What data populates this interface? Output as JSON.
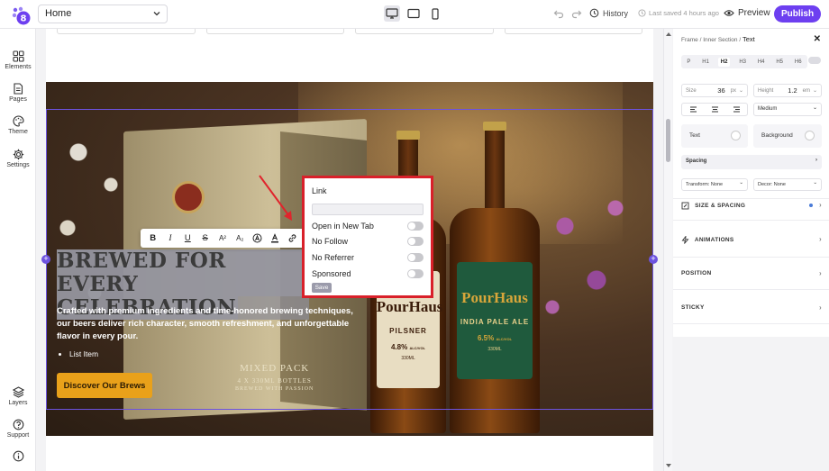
{
  "topbar": {
    "page_name": "Home",
    "history_label": "History",
    "saved_label": "Last saved 4 hours ago",
    "preview_label": "Preview",
    "publish_label": "Publish",
    "accent_color": "#6d3ff0"
  },
  "leftbar": {
    "items": [
      {
        "label": "Elements",
        "icon": "grid-icon"
      },
      {
        "label": "Pages",
        "icon": "document-icon"
      },
      {
        "label": "Theme",
        "icon": "palette-icon"
      },
      {
        "label": "Settings",
        "icon": "gear-icon"
      },
      {
        "label": "Layers",
        "icon": "layers-icon"
      },
      {
        "label": "Support",
        "icon": "help-icon"
      }
    ],
    "info_icon": "info-icon"
  },
  "hero": {
    "heading_line1": "BREWED FOR EVERY",
    "heading_line2": "CELEBRATION",
    "paragraph": "Crafted with premium ingredients and time-honored brewing techniques, our beers deliver rich character, smooth refreshment, and unforgettable flavor in every pour.",
    "list_item": "List Item",
    "cta_label": "Discover Our Brews",
    "box_label_1": "MIXED PACK",
    "box_label_2": "4 X 330ML BOTTLES",
    "box_label_3": "BREWED WITH PASSION",
    "bottle1": {
      "brand": "PourHaus",
      "style": "PILSNER",
      "abv": "4.8%",
      "abv_unit": "ALC/VOL",
      "volume": "330ML"
    },
    "bottle2": {
      "brand": "PourHaus",
      "style": "INDIA PALE ALE",
      "abv": "6.5%",
      "abv_unit": "ALC/VOL",
      "volume": "330ML"
    }
  },
  "text_toolbar": {
    "bold": "B",
    "italic": "I",
    "underline": "U",
    "strike": "S",
    "superscript": "A²",
    "subscript": "A₂"
  },
  "link_popup": {
    "title": "Link",
    "url_value": "",
    "options": [
      {
        "label": "Open in New Tab",
        "enabled": false
      },
      {
        "label": "No Follow",
        "enabled": false
      },
      {
        "label": "No Referrer",
        "enabled": false
      },
      {
        "label": "Sponsored",
        "enabled": false
      }
    ],
    "save_label": "Save",
    "highlight_color": "#d9202a"
  },
  "rightpanel": {
    "breadcrumb": [
      "Frame",
      "Inner Section",
      "Text"
    ],
    "tags": [
      "P",
      "H1",
      "H2",
      "H3",
      "H4",
      "H5",
      "H6"
    ],
    "active_tag": "H2",
    "size_label": "Size",
    "size_value": "36",
    "size_unit": "px",
    "height_label": "Height",
    "height_value": "1.2",
    "height_unit": "em",
    "weight_value": "Medium",
    "text_color_label": "Text",
    "background_label": "Background",
    "spacing_label": "Spacing",
    "transform_label": "Transform: None",
    "decor_label": "Decor: None",
    "sections": [
      "SIZE & SPACING",
      "ANIMATIONS",
      "POSITION",
      "STICKY"
    ]
  }
}
